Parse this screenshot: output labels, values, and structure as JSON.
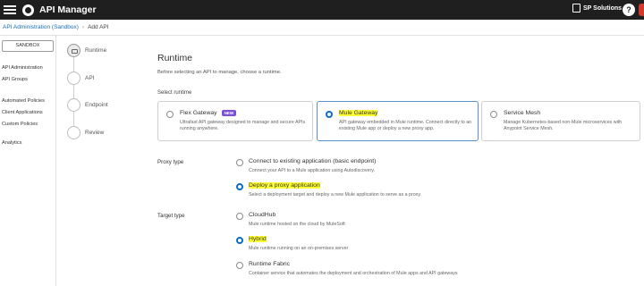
{
  "header": {
    "app_title": "API Manager",
    "org_name": "SP Solutions",
    "help_label": "?"
  },
  "breadcrumb": {
    "parent": "API Administration (Sandbox)",
    "current": "Add API"
  },
  "sidebar": {
    "environment": "SANDBOX",
    "items": [
      "API Administration",
      "API Groups",
      "Automated Policies",
      "Client Applications",
      "Custom Policies",
      "Analytics"
    ]
  },
  "steps": [
    "Runtime",
    "API",
    "Endpoint",
    "Review"
  ],
  "main": {
    "title": "Runtime",
    "intro": "Before selecting an API to manage, choose a runtime.",
    "select_runtime_label": "Select runtime",
    "runtimes": [
      {
        "title": "Flex Gateway",
        "badge": "NEW",
        "desc": "Ultrafast API gateway designed to manage and secure APIs running anywhere.",
        "selected": false
      },
      {
        "title": "Mule Gateway",
        "desc": "API gateway embedded in Mule runtime. Connect directly to an existing Mule app or deploy a new proxy app.",
        "selected": true
      },
      {
        "title": "Service Mesh",
        "desc": "Manage Kubernetes-based non-Mule microservices with Anypoint Service Mesh.",
        "selected": false
      }
    ],
    "proxy_type": {
      "label": "Proxy type",
      "options": [
        {
          "title": "Connect to existing application (basic endpoint)",
          "desc": "Connect your API to a Mule application using Autodiscovery.",
          "selected": false
        },
        {
          "title": "Deploy a proxy application",
          "desc": "Select a deployment target and deploy a new Mule application to serve as a proxy.",
          "selected": true
        }
      ]
    },
    "target_type": {
      "label": "Target type",
      "options": [
        {
          "title": "CloudHub",
          "desc": "Mule runtime hosted on the cloud by MuleSoft",
          "selected": false
        },
        {
          "title": "Hybrid",
          "desc": "Mule runtime running on an on-premises server",
          "selected": true
        },
        {
          "title": "Runtime Fabric",
          "desc": "Container service that automates the deployment and orchestration of Mule apps and API gateways",
          "selected": false
        }
      ]
    }
  },
  "colors": {
    "topbar": "#1f1f1f",
    "link": "#1a6fb5",
    "radio_selected": "#0b6bcb",
    "highlight": "#ffff33",
    "badge_new": "#7b4fd3"
  }
}
